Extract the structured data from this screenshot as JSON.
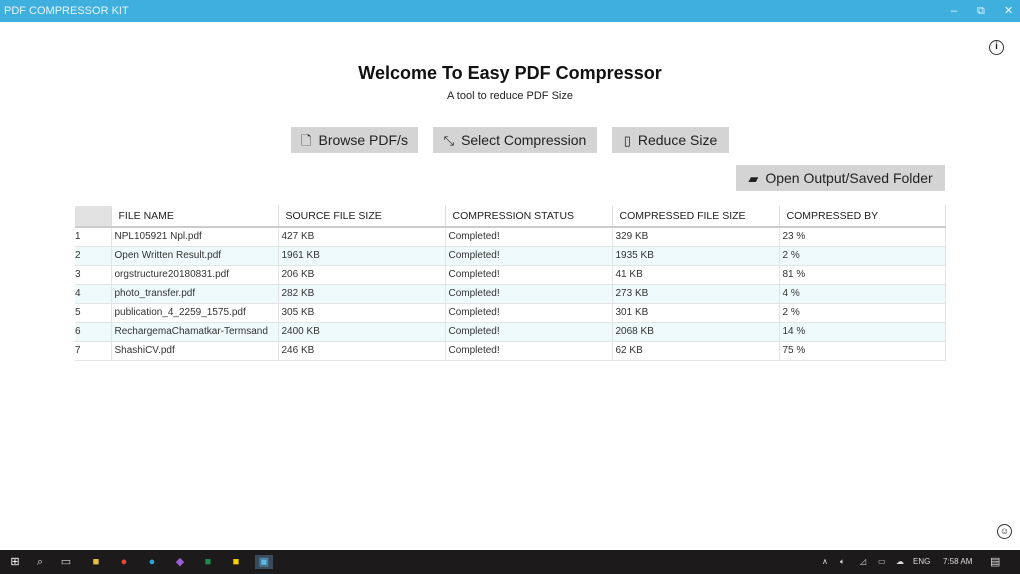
{
  "window": {
    "title": "PDF COMPRESSOR KIT",
    "minimize": "–",
    "restore": "⧉",
    "close": "✕"
  },
  "header": {
    "title": "Welcome To Easy PDF Compressor",
    "subtitle": "A tool to reduce PDF Size",
    "info_icon": "i",
    "feedback_icon": "☺"
  },
  "toolbar": {
    "browse": "Browse PDF/s",
    "select": "Select Compression",
    "reduce": "Reduce Size",
    "open_folder": "Open Output/Saved Folder"
  },
  "table": {
    "columns": [
      "FILE NAME",
      "SOURCE FILE SIZE",
      "COMPRESSION STATUS",
      "COMPRESSED FILE SIZE",
      "COMPRESSED BY"
    ],
    "rows": [
      {
        "n": "1",
        "name": "NPL105921 Npl.pdf",
        "src": "427 KB",
        "status": "Completed!",
        "comp": "329 KB",
        "by": "23 %"
      },
      {
        "n": "2",
        "name": "Open Written Result.pdf",
        "src": "1961 KB",
        "status": "Completed!",
        "comp": "1935 KB",
        "by": "2 %"
      },
      {
        "n": "3",
        "name": "orgstructure20180831.pdf",
        "src": "206 KB",
        "status": "Completed!",
        "comp": "41 KB",
        "by": "81 %"
      },
      {
        "n": "4",
        "name": "photo_transfer.pdf",
        "src": "282 KB",
        "status": "Completed!",
        "comp": "273 KB",
        "by": "4 %"
      },
      {
        "n": "5",
        "name": "publication_4_2259_1575.pdf",
        "src": "305 KB",
        "status": "Completed!",
        "comp": "301 KB",
        "by": "2 %"
      },
      {
        "n": "6",
        "name": "RechargemaChamatkar-Termsand",
        "src": "2400 KB",
        "status": "Completed!",
        "comp": "2068 KB",
        "by": "14 %"
      },
      {
        "n": "7",
        "name": "ShashiCV.pdf",
        "src": "246 KB",
        "status": "Completed!",
        "comp": "62 KB",
        "by": "75 %"
      }
    ]
  },
  "taskbar": {
    "lang": "ENG",
    "time": "7:58 AM"
  }
}
